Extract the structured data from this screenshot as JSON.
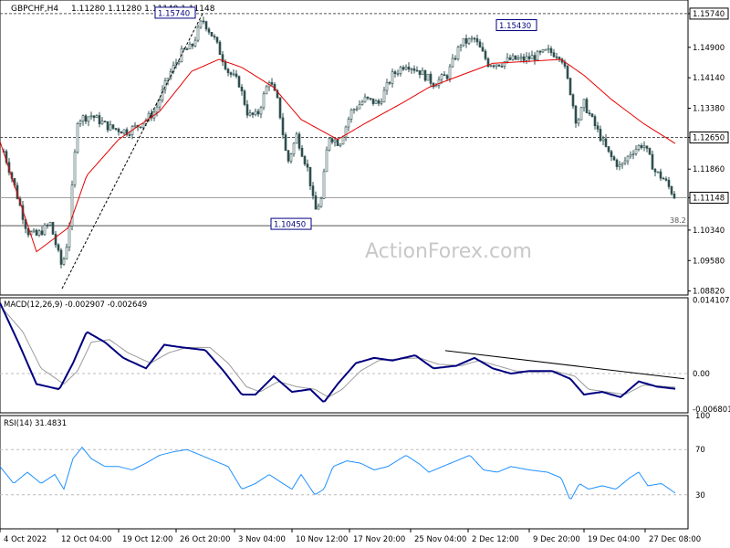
{
  "header": {
    "symbol": "GBPCHF,H4",
    "ohlc": "1.11280 1.11280 1.11140 1.11148"
  },
  "watermark": "ActionForex.com",
  "colors": {
    "candle": "#2f4f4f",
    "ema": "#e60000",
    "macd_line": "#000080",
    "macd_signal": "#9a9a9a",
    "rsi_line": "#1e90ff",
    "trendline": "#000000",
    "guide": "#555555"
  },
  "chart_data": [
    {
      "type": "candlestick",
      "pane": "price",
      "ylim": [
        1.0872,
        1.1608
      ],
      "y_ticks": [
        "1.15740",
        "1.14900",
        "1.14140",
        "1.13380",
        "1.12650",
        "1.11860",
        "1.11148",
        "1.10340",
        "1.09580",
        "1.08820"
      ],
      "x_ticks": [
        "4 Oct 2022",
        "12 Oct 04:00",
        "19 Oct 12:00",
        "26 Oct 20:00",
        "3 Nov 04:00",
        "10 Nov 12:00",
        "17 Nov 20:00",
        "25 Nov 04:00",
        "2 Dec 12:00",
        "9 Dec 20:00",
        "19 Dec 04:00",
        "27 Dec 08:00"
      ],
      "anchors_x": [
        0,
        63,
        130,
        193,
        257,
        320,
        383,
        450,
        513,
        580,
        640,
        707
      ],
      "anchor_closes": [
        [
          0,
          1.126
        ],
        [
          15,
          1.115
        ],
        [
          30,
          1.103
        ],
        [
          40,
          1.102
        ],
        [
          55,
          1.105
        ],
        [
          68,
          1.094
        ],
        [
          75,
          1.102
        ],
        [
          85,
          1.131
        ],
        [
          100,
          1.132
        ],
        [
          120,
          1.129
        ],
        [
          140,
          1.128
        ],
        [
          155,
          1.13
        ],
        [
          170,
          1.133
        ],
        [
          185,
          1.142
        ],
        [
          200,
          1.148
        ],
        [
          210,
          1.149
        ],
        [
          222,
          1.156
        ],
        [
          235,
          1.151
        ],
        [
          250,
          1.143
        ],
        [
          262,
          1.14
        ],
        [
          272,
          1.132
        ],
        [
          282,
          1.132
        ],
        [
          295,
          1.141
        ],
        [
          305,
          1.135
        ],
        [
          315,
          1.12
        ],
        [
          325,
          1.127
        ],
        [
          338,
          1.118
        ],
        [
          345,
          1.108
        ],
        [
          352,
          1.111
        ],
        [
          360,
          1.127
        ],
        [
          372,
          1.125
        ],
        [
          385,
          1.133
        ],
        [
          400,
          1.136
        ],
        [
          415,
          1.135
        ],
        [
          430,
          1.142
        ],
        [
          445,
          1.145
        ],
        [
          460,
          1.143
        ],
        [
          475,
          1.14
        ],
        [
          490,
          1.142
        ],
        [
          505,
          1.15
        ],
        [
          520,
          1.151
        ],
        [
          535,
          1.145
        ],
        [
          548,
          1.145
        ],
        [
          560,
          1.146
        ],
        [
          575,
          1.146
        ],
        [
          590,
          1.147
        ],
        [
          600,
          1.148
        ],
        [
          615,
          1.147
        ],
        [
          625,
          1.138
        ],
        [
          632,
          1.13
        ],
        [
          640,
          1.135
        ],
        [
          655,
          1.128
        ],
        [
          668,
          1.122
        ],
        [
          680,
          1.119
        ],
        [
          692,
          1.123
        ],
        [
          705,
          1.125
        ],
        [
          718,
          1.118
        ],
        [
          728,
          1.116
        ],
        [
          740,
          1.1115
        ]
      ],
      "series": [
        {
          "name": "",
          "values": [
            [
              0,
              1.1255
            ],
            [
              40,
              1.098
            ],
            [
              75,
              1.104
            ],
            [
              95,
              1.117
            ],
            [
              130,
              1.126
            ],
            [
              175,
              1.133
            ],
            [
              210,
              1.143
            ],
            [
              240,
              1.146
            ],
            [
              265,
              1.144
            ],
            [
              300,
              1.139
            ],
            [
              330,
              1.131
            ],
            [
              370,
              1.126
            ],
            [
              400,
              1.13
            ],
            [
              440,
              1.135
            ],
            [
              470,
              1.139
            ],
            [
              505,
              1.142
            ],
            [
              540,
              1.145
            ],
            [
              580,
              1.1455
            ],
            [
              615,
              1.146
            ],
            [
              640,
              1.142
            ],
            [
              670,
              1.136
            ],
            [
              705,
              1.13
            ],
            [
              740,
              1.125
            ]
          ]
        }
      ],
      "levels": [
        {
          "label": "1.15740",
          "value": 1.1574
        },
        {
          "label": "1.12650",
          "value": 1.1265
        },
        {
          "label": "",
          "value": 1.11148
        },
        {
          "label": "38.2",
          "value": 1.1045
        }
      ],
      "annotations": [
        {
          "text": "1.15740",
          "value": 1.1574
        },
        {
          "text": "1.15430",
          "value": 1.1543
        },
        {
          "text": "1.10450",
          "value": 1.1045
        }
      ],
      "current_price": "1.11148"
    },
    {
      "type": "line",
      "pane": "macd",
      "title": "MACD(12,26,9) -0.002907 -0.002649",
      "ylim": [
        -0.0075,
        0.0145
      ],
      "y_ticks": [
        "0.014107",
        "0.00",
        "-0.006801"
      ],
      "series": [
        {
          "name": "MACD",
          "values": [
            [
              0,
              0.0135
            ],
            [
              20,
              0.006
            ],
            [
              40,
              -0.002
            ],
            [
              65,
              -0.003
            ],
            [
              80,
              0.002
            ],
            [
              95,
              0.008
            ],
            [
              115,
              0.006
            ],
            [
              135,
              0.003
            ],
            [
              160,
              0.001
            ],
            [
              180,
              0.0055
            ],
            [
              200,
              0.005
            ],
            [
              225,
              0.0045
            ],
            [
              245,
              0.0005
            ],
            [
              265,
              -0.004
            ],
            [
              280,
              -0.004
            ],
            [
              300,
              -0.0005
            ],
            [
              320,
              -0.0035
            ],
            [
              340,
              -0.003
            ],
            [
              355,
              -0.0055
            ],
            [
              370,
              -0.002
            ],
            [
              390,
              0.002
            ],
            [
              410,
              0.003
            ],
            [
              430,
              0.0025
            ],
            [
              455,
              0.0035
            ],
            [
              475,
              0.001
            ],
            [
              500,
              0.0015
            ],
            [
              520,
              0.003
            ],
            [
              540,
              0.001
            ],
            [
              560,
              0.0
            ],
            [
              580,
              0.0005
            ],
            [
              605,
              0.0005
            ],
            [
              625,
              -0.001
            ],
            [
              640,
              -0.004
            ],
            [
              660,
              -0.0035
            ],
            [
              680,
              -0.0045
            ],
            [
              700,
              -0.0015
            ],
            [
              720,
              -0.0025
            ],
            [
              740,
              -0.0029
            ]
          ]
        },
        {
          "name": "Signal",
          "values": [
            [
              0,
              0.013
            ],
            [
              25,
              0.008
            ],
            [
              45,
              0.001
            ],
            [
              70,
              -0.002
            ],
            [
              85,
              0.0005
            ],
            [
              100,
              0.006
            ],
            [
              120,
              0.0065
            ],
            [
              140,
              0.004
            ],
            [
              165,
              0.002
            ],
            [
              185,
              0.004
            ],
            [
              205,
              0.005
            ],
            [
              230,
              0.005
            ],
            [
              250,
              0.002
            ],
            [
              270,
              -0.0025
            ],
            [
              285,
              -0.0035
            ],
            [
              305,
              -0.0015
            ],
            [
              325,
              -0.0025
            ],
            [
              345,
              -0.003
            ],
            [
              360,
              -0.0045
            ],
            [
              375,
              -0.003
            ],
            [
              395,
              0.0005
            ],
            [
              415,
              0.0025
            ],
            [
              435,
              0.0028
            ],
            [
              460,
              0.003
            ],
            [
              480,
              0.0018
            ],
            [
              505,
              0.0015
            ],
            [
              525,
              0.0025
            ],
            [
              545,
              0.0015
            ],
            [
              565,
              0.0005
            ],
            [
              585,
              0.0003
            ],
            [
              610,
              0.0004
            ],
            [
              630,
              -0.0005
            ],
            [
              645,
              -0.003
            ],
            [
              665,
              -0.0035
            ],
            [
              685,
              -0.004
            ],
            [
              705,
              -0.0022
            ],
            [
              725,
              -0.0024
            ],
            [
              740,
              -0.0026
            ]
          ]
        }
      ],
      "trendline": [
        [
          488,
          0.0044
        ],
        [
          750,
          -0.001
        ]
      ]
    },
    {
      "type": "line",
      "pane": "rsi",
      "title": "RSI(14) 31.4831",
      "ylim": [
        0,
        100
      ],
      "y_ticks": [
        "100",
        "70",
        "30"
      ],
      "levels": [
        70,
        30
      ],
      "series": [
        {
          "name": "RSI",
          "values": [
            [
              0,
              55
            ],
            [
              15,
              40
            ],
            [
              30,
              50
            ],
            [
              45,
              40
            ],
            [
              60,
              48
            ],
            [
              70,
              35
            ],
            [
              80,
              62
            ],
            [
              90,
              72
            ],
            [
              100,
              62
            ],
            [
              115,
              55
            ],
            [
              130,
              55
            ],
            [
              145,
              52
            ],
            [
              160,
              58
            ],
            [
              175,
              65
            ],
            [
              190,
              68
            ],
            [
              205,
              70
            ],
            [
              220,
              65
            ],
            [
              235,
              60
            ],
            [
              250,
              55
            ],
            [
              265,
              35
            ],
            [
              280,
              40
            ],
            [
              295,
              48
            ],
            [
              310,
              40
            ],
            [
              320,
              35
            ],
            [
              330,
              48
            ],
            [
              345,
              30
            ],
            [
              355,
              35
            ],
            [
              365,
              55
            ],
            [
              380,
              60
            ],
            [
              395,
              58
            ],
            [
              410,
              52
            ],
            [
              425,
              55
            ],
            [
              445,
              65
            ],
            [
              460,
              57
            ],
            [
              470,
              50
            ],
            [
              485,
              55
            ],
            [
              500,
              60
            ],
            [
              515,
              65
            ],
            [
              530,
              52
            ],
            [
              545,
              50
            ],
            [
              560,
              55
            ],
            [
              580,
              52
            ],
            [
              600,
              50
            ],
            [
              615,
              45
            ],
            [
              625,
              25
            ],
            [
              635,
              40
            ],
            [
              645,
              35
            ],
            [
              660,
              38
            ],
            [
              675,
              35
            ],
            [
              690,
              45
            ],
            [
              700,
              50
            ],
            [
              710,
              38
            ],
            [
              725,
              40
            ],
            [
              740,
              31.5
            ]
          ]
        }
      ]
    }
  ]
}
